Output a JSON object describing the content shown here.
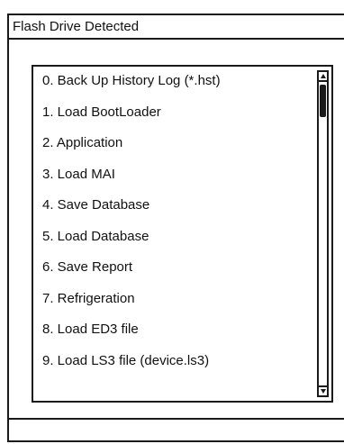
{
  "dialog": {
    "title": "Flash Drive Detected"
  },
  "list": {
    "items": [
      "0. Back Up History Log (*.hst)",
      "1. Load BootLoader",
      "2. Application",
      "3. Load MAI",
      "4. Save Database",
      "5. Load Database",
      "6. Save Report",
      "7. Refrigeration",
      "8. Load ED3 file",
      "9. Load LS3 file (device.ls3)"
    ]
  },
  "icons": {
    "scroll_up": "triangle-up-icon",
    "scroll_down": "triangle-down-icon"
  },
  "colors": {
    "border": "#1a1a1a",
    "background": "#ffffff",
    "text": "#111111"
  }
}
